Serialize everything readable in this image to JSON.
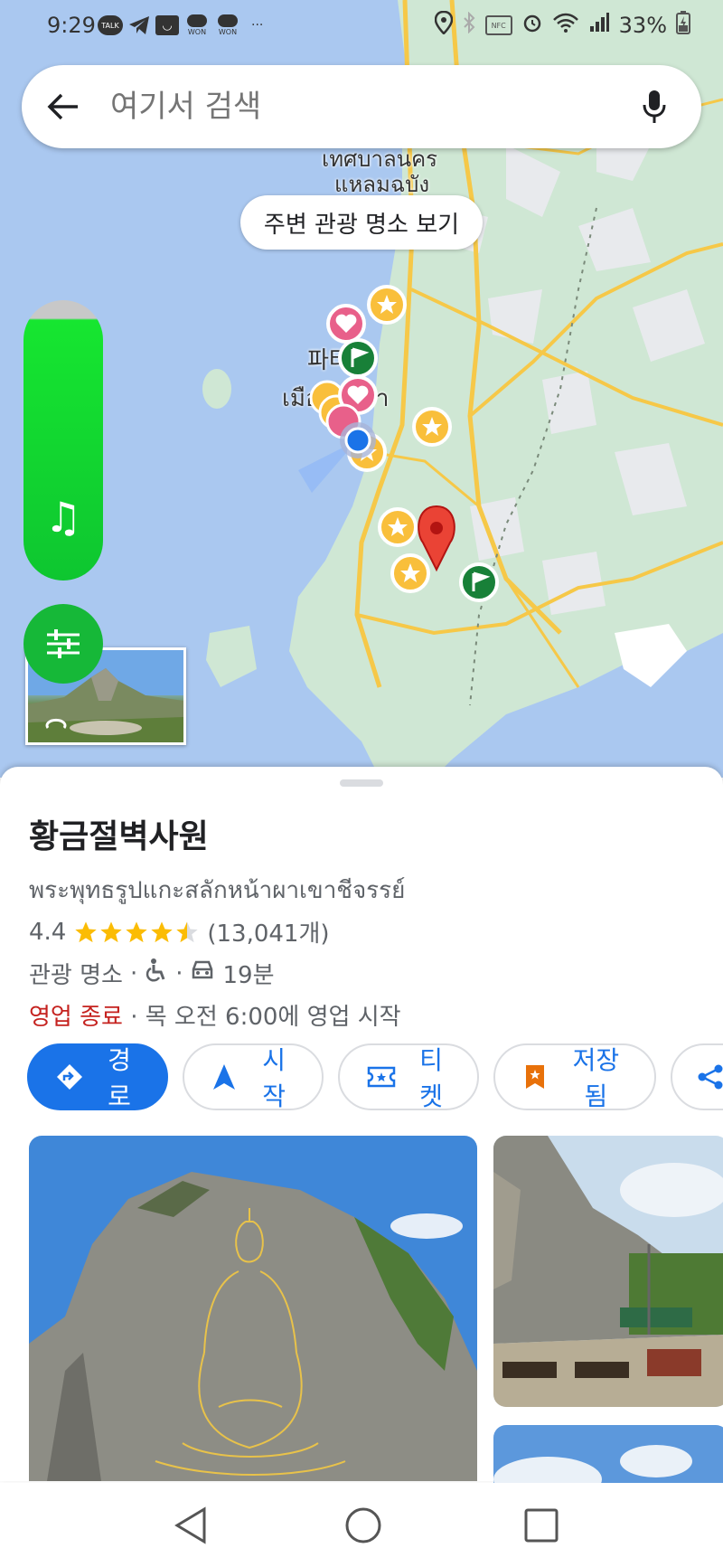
{
  "status_bar": {
    "time": "9:29",
    "app_icons": [
      "TALK",
      "telegram-icon",
      "box-icon",
      "WON",
      "WON"
    ],
    "more": "···",
    "nfc": "NFC",
    "battery": "33%"
  },
  "search": {
    "placeholder": "여기서 검색"
  },
  "map": {
    "labels": {
      "city_thai_top": "เทศบาลนคร",
      "city_thai_top2": "แหลมฉบัง",
      "pattaya_ko": "파타야",
      "pattaya_th": "เมืองพัทยา"
    },
    "nearby_chip": "주변 관광 명소 보기"
  },
  "place": {
    "title": "황금절벽사원",
    "subtitle": "พระพุทธรูปแกะสลักหน้าผาเขาชีจรรย์",
    "rating": "4.4",
    "stars": 4.4,
    "reviews": "(13,041개)",
    "category": "관광 명소",
    "drive_time": "19분",
    "status": "영업 종료",
    "hours_text": "· 목 오전 6:00에 영업 시작"
  },
  "actions": {
    "directions": "경로",
    "start": "시작",
    "tickets": "티켓",
    "saved": "저장됨"
  },
  "colors": {
    "accent": "#1a73e8",
    "closed": "#c5221f",
    "star": "#fbbc04",
    "map_water": "#aac8f0",
    "map_land": "#cfe7d4",
    "music_widget": "#16e630"
  }
}
